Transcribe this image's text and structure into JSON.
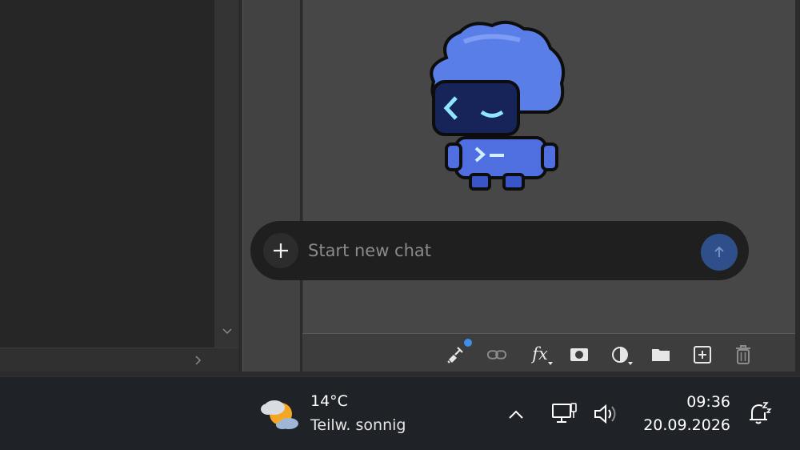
{
  "chat": {
    "placeholder": "Start new chat",
    "add_icon": "plus-icon",
    "send_icon": "arrow-up-icon"
  },
  "toolbar": {
    "icons": [
      "broom-icon",
      "link-icon",
      "function-icon",
      "camera-icon",
      "contrast-icon",
      "folder-icon",
      "add-box-icon",
      "trash-icon"
    ],
    "fx_label": "fx",
    "badge_color": "#3d8fe8"
  },
  "mascot": {
    "icon": "robot-mascot-icon",
    "body_color": "#5a7ee8",
    "face_color": "#1a2a66",
    "glyph_color": "#8fe6ff"
  },
  "taskbar": {
    "weather": {
      "temperature": "14°C",
      "description": "Teilw. sonnig",
      "icon": "partly-sunny-icon"
    },
    "clock": {
      "time": "09:36",
      "date": "20.09.2026"
    },
    "tray_icons": [
      "chevron-up-icon",
      "network-icon",
      "volume-icon",
      "notification-snooze-icon"
    ]
  },
  "colors": {
    "send_button": "#2e4f8a",
    "chat_bar": "#1f1f1f",
    "taskbar": "#1f2226"
  }
}
